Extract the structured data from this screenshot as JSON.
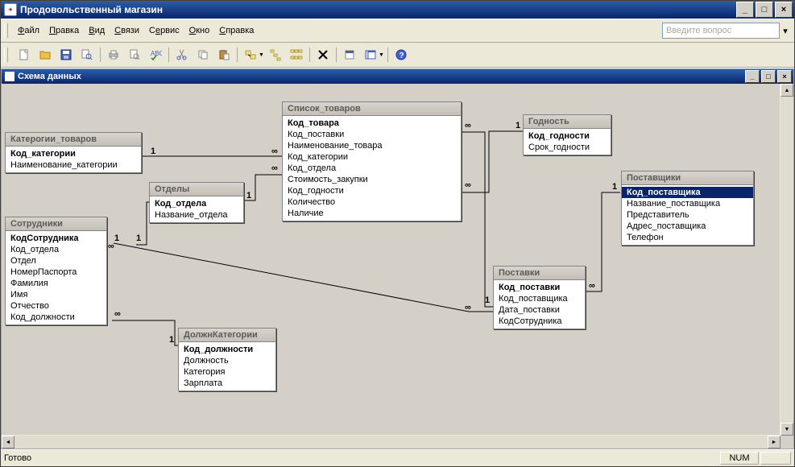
{
  "app_title": "Продовольственный магазин",
  "menus": {
    "file": "Файл",
    "edit": "Правка",
    "view": "Вид",
    "rel": "Связи",
    "service": "Сервис",
    "window": "Окно",
    "help": "Справка"
  },
  "help_placeholder": "Введите вопрос",
  "sub_title": "Схема данных",
  "status": {
    "ready": "Готово",
    "num": "NUM"
  },
  "tables": {
    "categories": {
      "title": "Катерогии_товаров",
      "fields": [
        {
          "n": "Код_категории",
          "pk": true
        },
        {
          "n": "Наименование_категории"
        }
      ]
    },
    "departments": {
      "title": "Отделы",
      "fields": [
        {
          "n": "Код_отдела",
          "pk": true
        },
        {
          "n": "Название_отдела"
        }
      ]
    },
    "employees": {
      "title": "Сотрудники",
      "fields": [
        {
          "n": "КодСотрудника",
          "pk": true
        },
        {
          "n": "Код_отдела"
        },
        {
          "n": "Отдел"
        },
        {
          "n": "НомерПаспорта"
        },
        {
          "n": "Фамилия"
        },
        {
          "n": "Имя"
        },
        {
          "n": "Отчество"
        },
        {
          "n": "Код_должности"
        }
      ]
    },
    "positions": {
      "title": "ДолжнКатегории",
      "fields": [
        {
          "n": "Код_должности",
          "pk": true
        },
        {
          "n": "Должность"
        },
        {
          "n": "Категория"
        },
        {
          "n": "Зарплата"
        }
      ]
    },
    "goods": {
      "title": "Список_товаров",
      "fields": [
        {
          "n": "Код_товара",
          "pk": true
        },
        {
          "n": "Код_поставки"
        },
        {
          "n": "Наименование_товара"
        },
        {
          "n": "Код_категории"
        },
        {
          "n": "Код_отдела"
        },
        {
          "n": "Стоимость_закупки"
        },
        {
          "n": "Код_годности"
        },
        {
          "n": "Количество"
        },
        {
          "n": "Наличие"
        }
      ]
    },
    "shelf": {
      "title": "Годность",
      "fields": [
        {
          "n": "Код_годности",
          "pk": true
        },
        {
          "n": "Срок_годности"
        }
      ]
    },
    "deliveries": {
      "title": "Поставки",
      "fields": [
        {
          "n": "Код_поставки",
          "pk": true
        },
        {
          "n": "Код_поставщика"
        },
        {
          "n": "Дата_поставки"
        },
        {
          "n": "КодСотрудника"
        }
      ]
    },
    "suppliers": {
      "title": "Поставщики",
      "fields": [
        {
          "n": "Код_поставщика",
          "pk": true,
          "sel": true
        },
        {
          "n": "Название_поставщика"
        },
        {
          "n": "Представитель"
        },
        {
          "n": "Адрес_поставщика"
        },
        {
          "n": "Телефон"
        }
      ]
    }
  },
  "labels": {
    "one": "1",
    "many": "∞"
  }
}
